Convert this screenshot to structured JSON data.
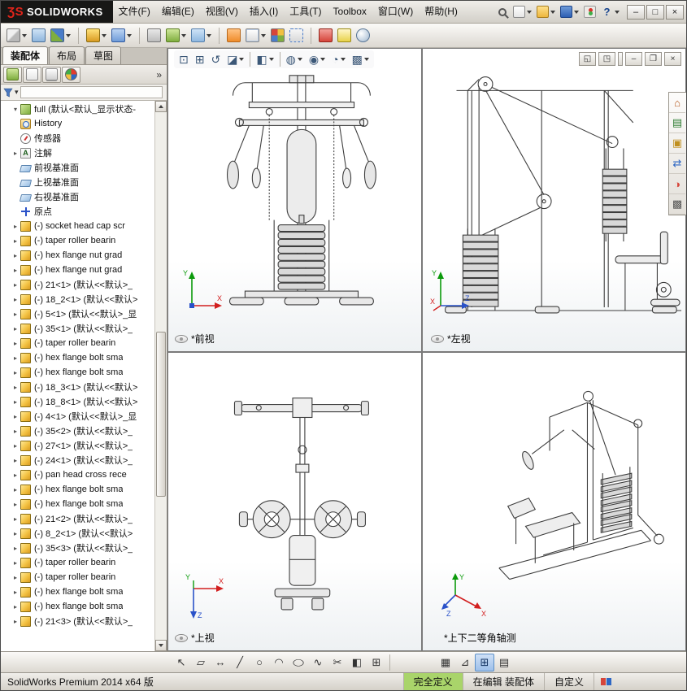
{
  "titlebar": {
    "logo": {
      "mark": "ƷS",
      "text": "SOLIDWORKS"
    },
    "menus": [
      "文件(F)",
      "编辑(E)",
      "视图(V)",
      "插入(I)",
      "工具(T)",
      "Toolbox",
      "窗口(W)",
      "帮助(H)"
    ],
    "quick_icons": [
      {
        "n": "search-icon",
        "c": "g-search",
        "dd": false
      },
      {
        "n": "new-document-button",
        "c": "g-page",
        "dd": true
      },
      {
        "n": "open-document-button",
        "c": "g-folder",
        "dd": true
      },
      {
        "n": "save-button",
        "c": "g-disk",
        "dd": true
      },
      {
        "n": "options-button",
        "c": "g-traffic",
        "dd": false
      },
      {
        "n": "help-button",
        "c": "g-help",
        "g": "?",
        "dd": true
      }
    ],
    "window_buttons": [
      {
        "n": "minimize-button",
        "g": "–"
      },
      {
        "n": "maximize-button",
        "g": "□"
      },
      {
        "n": "close-button",
        "g": "×"
      }
    ]
  },
  "assembly_toolbar": [
    {
      "n": "insert-components-button",
      "c": "g-greycube",
      "dd": true
    },
    {
      "n": "mate-button",
      "c": "g-clip",
      "dd": false
    },
    {
      "n": "linear-component-pattern-button",
      "c": "g-pattern",
      "dd": true
    },
    {
      "n": "separator",
      "c": "sep"
    },
    {
      "n": "smart-fasteners-button",
      "c": "g-bolt",
      "dd": true
    },
    {
      "n": "move-component-button",
      "c": "g-move",
      "dd": true
    },
    {
      "n": "separator",
      "c": "sep"
    },
    {
      "n": "show-hidden-components-button",
      "c": "g-glasses",
      "dd": false
    },
    {
      "n": "assembly-features-button",
      "c": "g-feat",
      "dd": true
    },
    {
      "n": "reference-geometry-button",
      "c": "g-ref",
      "dd": true
    },
    {
      "n": "separator",
      "c": "sep"
    },
    {
      "n": "new-motion-study-button",
      "c": "g-motion",
      "dd": false
    },
    {
      "n": "bill-of-materials-button",
      "c": "g-bom",
      "dd": true
    },
    {
      "n": "exploded-view-button",
      "c": "g-explode",
      "dd": false
    },
    {
      "n": "explode-line-sketch-button",
      "c": "g-expline",
      "dd": false
    },
    {
      "n": "separator",
      "c": "sep"
    },
    {
      "n": "interference-detection-button",
      "c": "g-interf",
      "dd": false
    },
    {
      "n": "measure-button",
      "c": "g-measure",
      "dd": false
    },
    {
      "n": "mass-properties-button",
      "c": "g-mass",
      "dd": false
    }
  ],
  "feature_panel": {
    "tabs": [
      {
        "label": "装配体",
        "c": "active",
        "n": "tab-assembly"
      },
      {
        "label": "布局",
        "c": "",
        "n": "tab-layout"
      },
      {
        "label": "草图",
        "c": "",
        "n": "tab-sketch"
      }
    ],
    "manager_tabs": [
      {
        "n": "featuremanager-tree-tab",
        "c": "g-feat"
      },
      {
        "n": "propertymanager-tab",
        "c": "g-page"
      },
      {
        "n": "configurationmanager-tab",
        "c": "g-config"
      },
      {
        "n": "displaymanager-tab",
        "c": "g-ball"
      }
    ],
    "overflow_chevron": "»",
    "filter_dropdown": "▾"
  },
  "tree": [
    {
      "e": "▾",
      "i": "ti-asm",
      "n": "assembly-icon",
      "label": "full (默认<默认_显示状态-"
    },
    {
      "e": "",
      "i": "ti-hist",
      "n": "history-folder-icon",
      "label": "History"
    },
    {
      "e": "",
      "i": "ti-sens",
      "n": "sensors-icon",
      "label": "传感器"
    },
    {
      "e": "▸",
      "i": "ti-anno",
      "n": "annotations-icon",
      "label": "注解"
    },
    {
      "e": "",
      "i": "ti-plane",
      "n": "front-plane-icon",
      "label": "前视基准面"
    },
    {
      "e": "",
      "i": "ti-plane",
      "n": "top-plane-icon",
      "label": "上视基准面"
    },
    {
      "e": "",
      "i": "ti-plane",
      "n": "right-plane-icon",
      "label": "右视基准面"
    },
    {
      "e": "",
      "i": "ti-origin",
      "n": "origin-icon",
      "label": "原点"
    },
    {
      "e": "▸",
      "i": "ti-part",
      "n": "part-icon",
      "label": "(-) socket head cap scr"
    },
    {
      "e": "▸",
      "i": "ti-part",
      "n": "part-icon",
      "label": "(-) taper roller bearin"
    },
    {
      "e": "▸",
      "i": "ti-part",
      "n": "part-icon",
      "label": "(-) hex flange nut grad"
    },
    {
      "e": "▸",
      "i": "ti-part",
      "n": "part-icon",
      "label": "(-) hex flange nut grad"
    },
    {
      "e": "▸",
      "i": "ti-part",
      "n": "part-icon",
      "label": "(-) 21<1> (默认<<默认>_"
    },
    {
      "e": "▸",
      "i": "ti-part",
      "n": "part-icon",
      "label": "(-) 18_2<1> (默认<<默认>"
    },
    {
      "e": "▸",
      "i": "ti-part",
      "n": "part-icon",
      "label": "(-) 5<1> (默认<<默认>_显"
    },
    {
      "e": "▸",
      "i": "ti-part",
      "n": "part-icon",
      "label": "(-) 35<1> (默认<<默认>_"
    },
    {
      "e": "▸",
      "i": "ti-part",
      "n": "part-icon",
      "label": "(-) taper roller bearin"
    },
    {
      "e": "▸",
      "i": "ti-part",
      "n": "part-icon",
      "label": "(-) hex flange bolt sma"
    },
    {
      "e": "▸",
      "i": "ti-part",
      "n": "part-icon",
      "label": "(-) hex flange bolt sma"
    },
    {
      "e": "▸",
      "i": "ti-part",
      "n": "part-icon",
      "label": "(-) 18_3<1> (默认<<默认>"
    },
    {
      "e": "▸",
      "i": "ti-part",
      "n": "part-icon",
      "label": "(-) 18_8<1> (默认<<默认>"
    },
    {
      "e": "▸",
      "i": "ti-part",
      "n": "part-icon",
      "label": "(-) 4<1> (默认<<默认>_显"
    },
    {
      "e": "▸",
      "i": "ti-part",
      "n": "part-icon",
      "label": "(-) 35<2> (默认<<默认>_"
    },
    {
      "e": "▸",
      "i": "ti-part",
      "n": "part-icon",
      "label": "(-) 27<1> (默认<<默认>_"
    },
    {
      "e": "▸",
      "i": "ti-part",
      "n": "part-icon",
      "label": "(-) 24<1> (默认<<默认>_"
    },
    {
      "e": "▸",
      "i": "ti-part",
      "n": "part-icon",
      "label": "(-) pan head cross rece"
    },
    {
      "e": "▸",
      "i": "ti-part",
      "n": "part-icon",
      "label": "(-) hex flange bolt sma"
    },
    {
      "e": "▸",
      "i": "ti-part",
      "n": "part-icon",
      "label": "(-) hex flange bolt sma"
    },
    {
      "e": "▸",
      "i": "ti-part",
      "n": "part-icon",
      "label": "(-) 21<2> (默认<<默认>_"
    },
    {
      "e": "▸",
      "i": "ti-part",
      "n": "part-icon",
      "label": "(-) 8_2<1> (默认<<默认>"
    },
    {
      "e": "▸",
      "i": "ti-part",
      "n": "part-icon",
      "label": "(-) 35<3> (默认<<默认>_"
    },
    {
      "e": "▸",
      "i": "ti-part",
      "n": "part-icon",
      "label": "(-) taper roller bearin"
    },
    {
      "e": "▸",
      "i": "ti-part",
      "n": "part-icon",
      "label": "(-) taper roller bearin"
    },
    {
      "e": "▸",
      "i": "ti-part",
      "n": "part-icon",
      "label": "(-) hex flange bolt sma"
    },
    {
      "e": "▸",
      "i": "ti-part",
      "n": "part-icon",
      "label": "(-) hex flange bolt sma"
    },
    {
      "e": "▸",
      "i": "ti-part",
      "n": "part-icon",
      "label": "(-) 21<3> (默认<<默认>_"
    }
  ],
  "headsup": [
    {
      "n": "zoom-to-fit-button",
      "g": "⊡",
      "dd": false
    },
    {
      "n": "zoom-to-area-button",
      "g": "⊞",
      "dd": false
    },
    {
      "n": "previous-view-button",
      "g": "↺",
      "dd": false
    },
    {
      "n": "section-view-button",
      "g": "◪",
      "dd": true
    },
    {
      "n": "separator",
      "c": "hsep"
    },
    {
      "n": "view-orientation-button",
      "g": "◧",
      "dd": true
    },
    {
      "n": "separator",
      "c": "hsep"
    },
    {
      "n": "display-style-button",
      "g": "◍",
      "dd": true
    },
    {
      "n": "hide-show-items-button",
      "g": "◉",
      "dd": true
    },
    {
      "n": "edit-appearance-button",
      "g": "◔",
      "dd": true
    },
    {
      "n": "apply-scene-button",
      "g": "▩",
      "dd": true
    }
  ],
  "window_controls": [
    {
      "n": "tile-window-button",
      "g": "◱"
    },
    {
      "n": "cascade-window-button",
      "g": "◳"
    },
    {
      "n": "gap",
      "c": "wc-gap"
    },
    {
      "n": "child-minimize-button",
      "g": "–"
    },
    {
      "n": "child-restore-button",
      "g": "❐"
    },
    {
      "n": "child-close-button",
      "g": "×"
    }
  ],
  "viewports": [
    {
      "label": "*前视"
    },
    {
      "label": "*左视"
    },
    {
      "label": "*上视"
    },
    {
      "label": "*上下二等角轴测"
    }
  ],
  "triad": {
    "x": "X",
    "y": "Y",
    "z": "Z"
  },
  "taskpane": [
    {
      "n": "solidworks-resources-tab",
      "g": "⌂",
      "c": "tp-home"
    },
    {
      "n": "design-library-tab",
      "g": "▤",
      "c": "tp-lib"
    },
    {
      "n": "file-explorer-tab",
      "g": "▣",
      "c": "tp-files"
    },
    {
      "n": "view-palette-tab",
      "g": "⇄",
      "c": "tp-pal"
    },
    {
      "n": "appearances-scenes-tab",
      "g": "◑",
      "c": "tp-app"
    },
    {
      "n": "custom-properties-tab",
      "g": "▩",
      "c": "tp-props"
    }
  ],
  "sketchbar": [
    {
      "n": "select-tool-button",
      "g": "↖"
    },
    {
      "n": "sketch-button",
      "g": "▱"
    },
    {
      "n": "smart-dimension-button",
      "g": "↔"
    },
    {
      "n": "line-tool-button",
      "g": "╱"
    },
    {
      "n": "circle-tool-button",
      "g": "○"
    },
    {
      "n": "arc-tool-button",
      "g": "◠"
    },
    {
      "n": "ellipse-tool-button",
      "g": "◯",
      "c": "squish"
    },
    {
      "n": "spline-tool-button",
      "g": "∿"
    },
    {
      "n": "trim-tool-button",
      "g": "✂"
    },
    {
      "n": "mirror-tool-button",
      "g": "◧"
    },
    {
      "n": "pattern-tool-button",
      "g": "⊞"
    },
    {
      "n": "separator",
      "c": "sep"
    },
    {
      "n": "grid-snap-button",
      "g": "▦",
      "c": "rgap"
    },
    {
      "n": "quick-snaps-button",
      "g": "⊿"
    },
    {
      "n": "viewport-layout-button",
      "g": "⊞",
      "c": "active"
    },
    {
      "n": "evaluate-table-button",
      "g": "▤"
    }
  ],
  "statusbar": {
    "app_version": "SolidWorks Premium 2014 x64 版",
    "define_state": "完全定义",
    "editing_state": "在编辑 装配体",
    "custom_tab": "自定义"
  }
}
